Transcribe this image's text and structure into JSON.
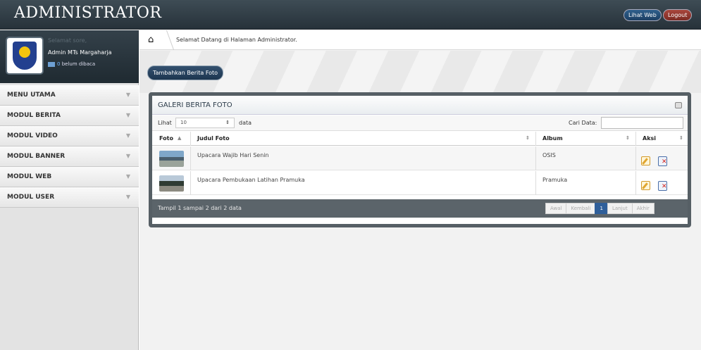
{
  "header": {
    "brand": "ADMINISTRATOR",
    "lihat_web": "Lihat Web",
    "logout": "Logout"
  },
  "user": {
    "greeting": "Selamat sore,",
    "name": "Admin MTs Margaharja",
    "unread_count": "0",
    "unread_label": "belum dibaca"
  },
  "menu": {
    "items": [
      {
        "label": "MENU UTAMA"
      },
      {
        "label": "MODUL BERITA"
      },
      {
        "label": "MODUL VIDEO"
      },
      {
        "label": "MODUL BANNER"
      },
      {
        "label": "MODUL WEB"
      },
      {
        "label": "MODUL USER"
      }
    ]
  },
  "breadcrumb": {
    "text": "Selamat Datang di Halaman Administrator."
  },
  "actions": {
    "add_label": "Tambahkan Berita Foto"
  },
  "panel": {
    "title": "GALERI BERITA FOTO",
    "lihat_label": "Lihat",
    "page_size": "10",
    "data_label": "data",
    "search_label": "Cari Data:",
    "columns": [
      "Foto",
      "Judul Foto",
      "Album",
      "Aksi"
    ],
    "rows": [
      {
        "judul": "Upacara Wajib Hari Senin",
        "album": "OSIS"
      },
      {
        "judul": "Upacara Pembukaan Latihan Pramuka",
        "album": "Pramuka"
      }
    ],
    "info": "Tampil 1 sampai 2 dari 2 data",
    "pager": [
      "Awal",
      "Kembali",
      "1",
      "Lanjut",
      "Akhir"
    ]
  }
}
